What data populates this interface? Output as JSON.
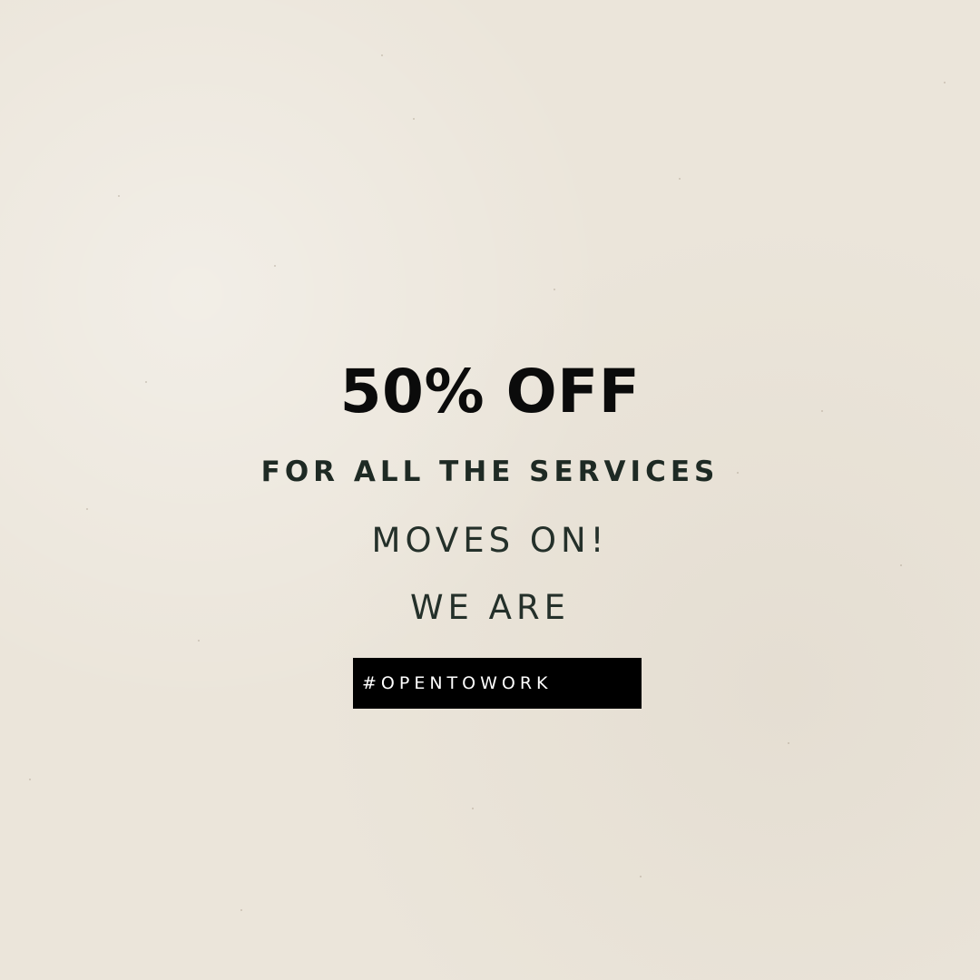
{
  "promo": {
    "headline": "50% OFF",
    "subheadline": "FOR ALL THE SERVICES",
    "line_moves": "MOVES ON!",
    "line_we_are": "WE ARE",
    "hashtag": "#OPENTOWORK"
  },
  "colors": {
    "background": "#ebe5da",
    "text_dark": "#0b0b0b",
    "text_green": "#1e2a24",
    "tag_background": "#000000",
    "tag_text": "#ffffff"
  }
}
